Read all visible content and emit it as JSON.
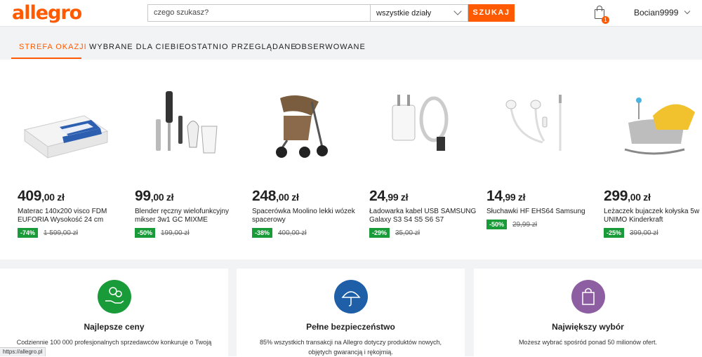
{
  "header": {
    "logo": "allegro",
    "search_placeholder": "czego szukasz?",
    "department": "wszystkie działy",
    "search_button": "SZUKAJ",
    "cart_count": "1",
    "username": "Bocian9999"
  },
  "tabs": [
    {
      "label": "STREFA OKAZJI",
      "active": true
    },
    {
      "label": "WYBRANE DLA CIEBIE",
      "active": false
    },
    {
      "label": "OSTATNIO PRZEGLĄDANE",
      "active": false
    },
    {
      "label": "OBSERWOWANE",
      "active": false
    }
  ],
  "products": [
    {
      "price_int": "409",
      "price_dec": ",00 zł",
      "name": "Materac 140x200 visco FDM EUFORIA Wysokość 24 cm",
      "discount": "-74%",
      "old_price": "1 599,00 zł"
    },
    {
      "price_int": "99",
      "price_dec": ",00 zł",
      "name": "Blender ręczny wielofunkcyjny mikser 3w1 GC MIXME",
      "discount": "-50%",
      "old_price": "199,00 zł"
    },
    {
      "price_int": "248",
      "price_dec": ",00 zł",
      "name": "Spacerówka Moolino lekki wózek spacerowy",
      "discount": "-38%",
      "old_price": "400,00 zł"
    },
    {
      "price_int": "24",
      "price_dec": ",99 zł",
      "name": "Ładowarka kabel USB SAMSUNG Galaxy S3 S4 S5 S6 S7",
      "discount": "-29%",
      "old_price": "35,00 zł"
    },
    {
      "price_int": "14",
      "price_dec": ",99 zł",
      "name": "Słuchawki HF EHS64 Samsung",
      "discount": "-50%",
      "old_price": "29,99 zł"
    },
    {
      "price_int": "299",
      "price_dec": ",00 zł",
      "name": "Leżaczek bujaczek kołyska 5w UNIMO Kinderkraft",
      "discount": "-25%",
      "old_price": "399,00 zł"
    }
  ],
  "features": [
    {
      "title": "Najlepsze ceny",
      "desc": "Codziennie 100 000 profesjonalnych sprzedawców konkuruje o Twoją",
      "color": "#1a9b3a"
    },
    {
      "title": "Pełne bezpieczeństwo",
      "desc": "85% wszystkich transakcji na Allegro dotyczy produktów nowych, objętych gwarancją i rękojmią.",
      "color": "#1f5fa8"
    },
    {
      "title": "Największy wybór",
      "desc": "Możesz wybrać spośród ponad 50 milionów ofert.",
      "color": "#8e5ea2"
    }
  ],
  "status_url": "https://allegro.pl"
}
